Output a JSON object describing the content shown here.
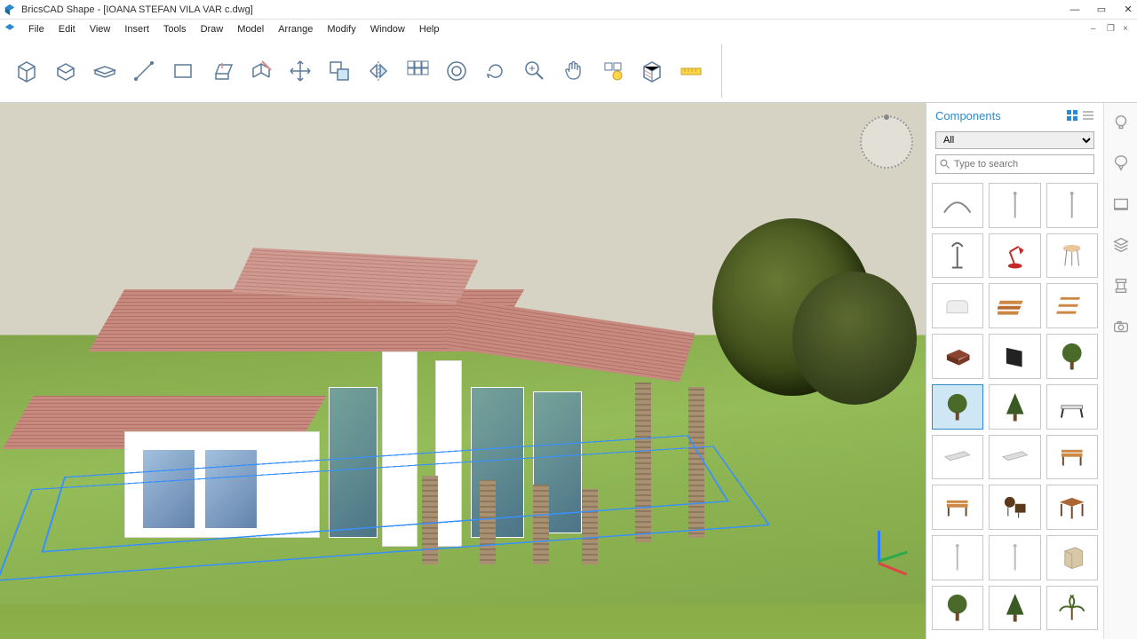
{
  "titlebar": {
    "title": "BricsCAD Shape - [IOANA STEFAN VILA VAR  c.dwg]"
  },
  "menu": {
    "items": [
      "File",
      "Edit",
      "View",
      "Insert",
      "Tools",
      "Draw",
      "Model",
      "Arrange",
      "Modify",
      "Window",
      "Help"
    ]
  },
  "toolbar": {
    "tools": [
      {
        "name": "box-tool",
        "title": "Box"
      },
      {
        "name": "extrude-tool",
        "title": "Extrude"
      },
      {
        "name": "slab-tool",
        "title": "Slab"
      },
      {
        "name": "line-tool",
        "title": "Line"
      },
      {
        "name": "rectangle-tool",
        "title": "Rectangle"
      },
      {
        "name": "pushpull-tool",
        "title": "Push/Pull"
      },
      {
        "name": "section-tool",
        "title": "Section"
      },
      {
        "name": "move-tool",
        "title": "Move"
      },
      {
        "name": "copy-tool",
        "title": "Copy"
      },
      {
        "name": "mirror-tool",
        "title": "Mirror"
      },
      {
        "name": "array-tool",
        "title": "Array"
      },
      {
        "name": "offset-tool",
        "title": "Offset"
      },
      {
        "name": "rotate-tool",
        "title": "Rotate"
      },
      {
        "name": "zoom-tool",
        "title": "Zoom"
      },
      {
        "name": "pan-tool",
        "title": "Pan"
      },
      {
        "name": "light-tool",
        "title": "Light"
      },
      {
        "name": "material-tool",
        "title": "Material"
      },
      {
        "name": "measure-tool",
        "title": "Measure"
      }
    ]
  },
  "panel": {
    "title": "Components",
    "filter_value": "All",
    "search_placeholder": "Type to search"
  },
  "components": [
    {
      "name": "curve",
      "color": "#888"
    },
    {
      "name": "pole-light",
      "color": "#aaa"
    },
    {
      "name": "post",
      "color": "#aaa"
    },
    {
      "name": "floor-lamp",
      "color": "#888"
    },
    {
      "name": "desk-lamp",
      "color": "#c62828"
    },
    {
      "name": "stool",
      "color": "#e8c79a"
    },
    {
      "name": "sofa-white",
      "color": "#eee"
    },
    {
      "name": "lumber-stack",
      "color": "#cc8844"
    },
    {
      "name": "shelves",
      "color": "#cc8844"
    },
    {
      "name": "brick",
      "color": "#8a4430"
    },
    {
      "name": "screen",
      "color": "#222"
    },
    {
      "name": "tree-round",
      "color": "#4a6a2a"
    },
    {
      "name": "tree-ball",
      "color": "#4a6a2a",
      "selected": true
    },
    {
      "name": "tree-cone",
      "color": "#3a5a24"
    },
    {
      "name": "bench-simple",
      "color": "#333"
    },
    {
      "name": "step",
      "color": "#ddd"
    },
    {
      "name": "beam",
      "color": "#ddd"
    },
    {
      "name": "bench-wood",
      "color": "#cc8844"
    },
    {
      "name": "park-bench",
      "color": "#cc8844"
    },
    {
      "name": "chair-set",
      "color": "#5a3a1a"
    },
    {
      "name": "table",
      "color": "#aa6633"
    },
    {
      "name": "pole1",
      "color": "#bbb"
    },
    {
      "name": "pole2",
      "color": "#bbb"
    },
    {
      "name": "cabinet",
      "color": "#d8c8a8"
    },
    {
      "name": "tree-oak",
      "color": "#4a6a2a"
    },
    {
      "name": "tree-pine",
      "color": "#3a5a24"
    },
    {
      "name": "tree-palm",
      "color": "#4a6a2a"
    }
  ],
  "side_tools": [
    {
      "name": "light-panel-icon",
      "title": "Lights"
    },
    {
      "name": "balloon-icon",
      "title": "Sky"
    },
    {
      "name": "view-panel-icon",
      "title": "Views"
    },
    {
      "name": "layers-panel-icon",
      "title": "Layers"
    },
    {
      "name": "structure-panel-icon",
      "title": "Structure"
    },
    {
      "name": "camera-panel-icon",
      "title": "Camera"
    }
  ]
}
